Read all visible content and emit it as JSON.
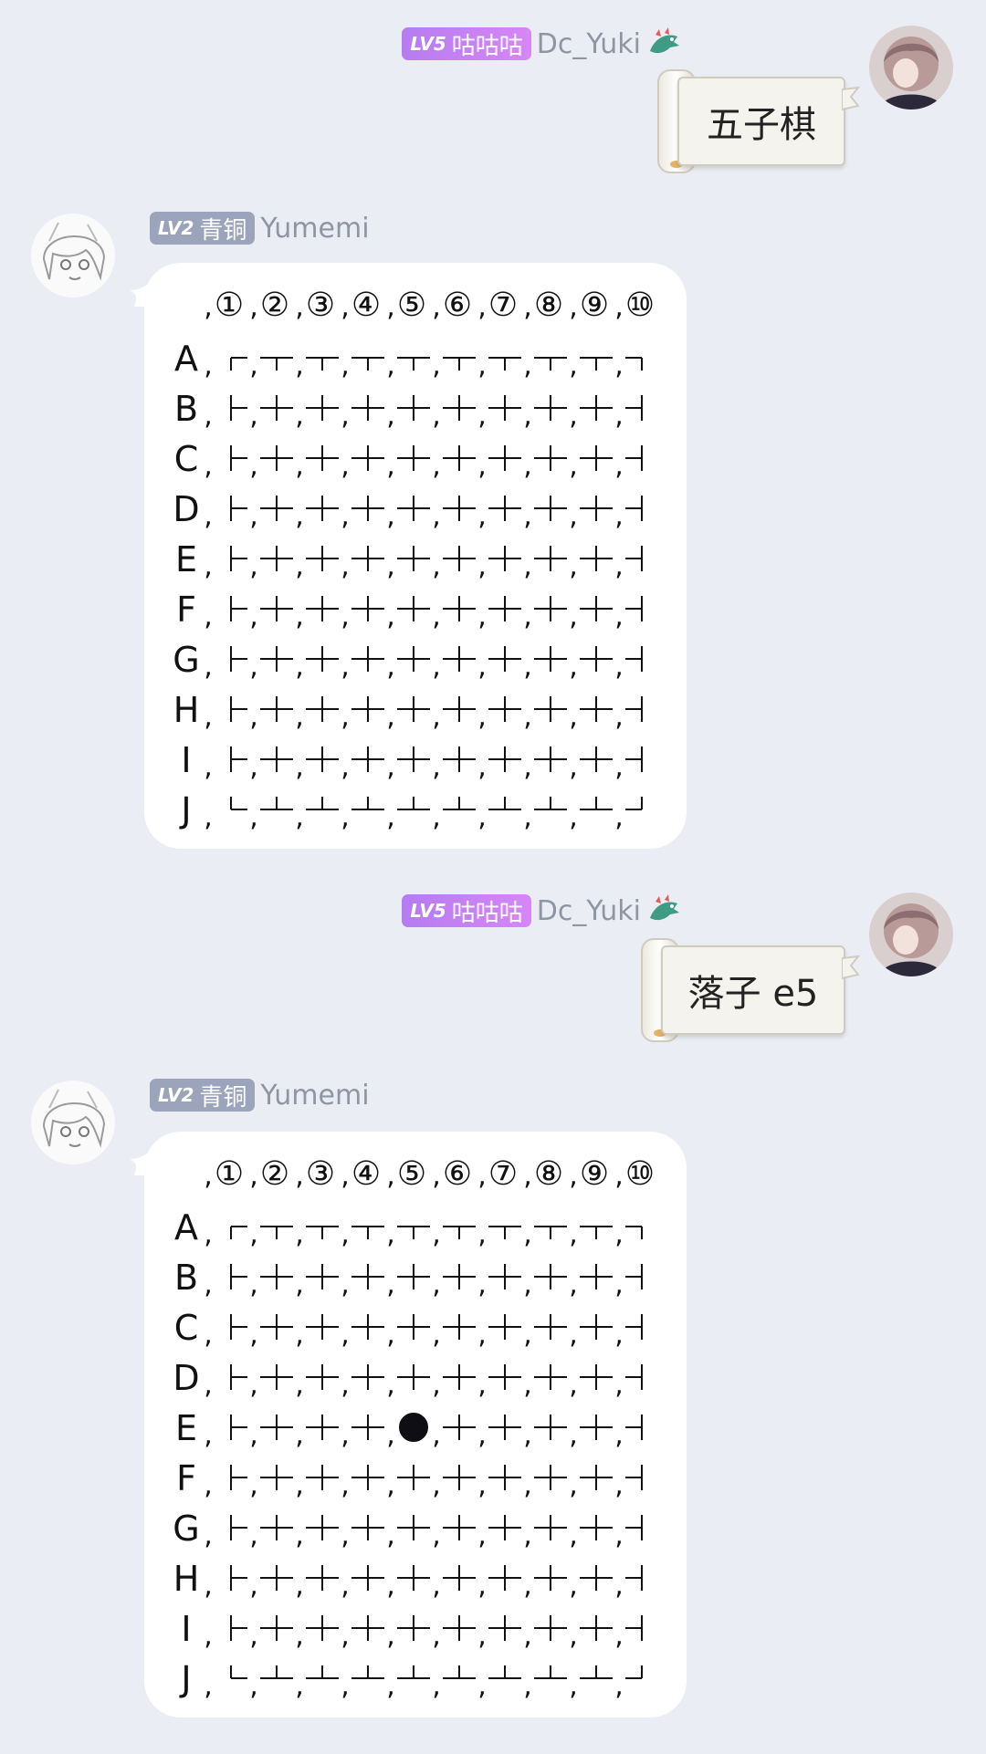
{
  "messages": [
    {
      "side": "right",
      "level": "LV5",
      "title": "咕咕咕",
      "username": "Dc_Yuki",
      "text": "五子棋"
    },
    {
      "side": "left",
      "level": "LV2",
      "title": "青铜",
      "username": "Yumemi",
      "board": {
        "col_labels": [
          "①",
          "②",
          "③",
          "④",
          "⑤",
          "⑥",
          "⑦",
          "⑧",
          "⑨",
          "⑩"
        ],
        "row_labels": [
          "A",
          "B",
          "C",
          "D",
          "E",
          "F",
          "G",
          "H",
          "I",
          "J"
        ],
        "separator": ",",
        "stones": []
      }
    },
    {
      "side": "right",
      "level": "LV5",
      "title": "咕咕咕",
      "username": "Dc_Yuki",
      "text": "落子 e5"
    },
    {
      "side": "left",
      "level": "LV2",
      "title": "青铜",
      "username": "Yumemi",
      "board": {
        "col_labels": [
          "①",
          "②",
          "③",
          "④",
          "⑤",
          "⑥",
          "⑦",
          "⑧",
          "⑨",
          "⑩"
        ],
        "row_labels": [
          "A",
          "B",
          "C",
          "D",
          "E",
          "F",
          "G",
          "H",
          "I",
          "J"
        ],
        "separator": ",",
        "stones": [
          {
            "row": "E",
            "col": 5,
            "color": "black"
          }
        ]
      }
    }
  ],
  "colors": {
    "background": "#eaedf4",
    "badge_lv5": "#c07ef4",
    "badge_lv2": "#9ba4ba",
    "username": "#8f96a3"
  }
}
